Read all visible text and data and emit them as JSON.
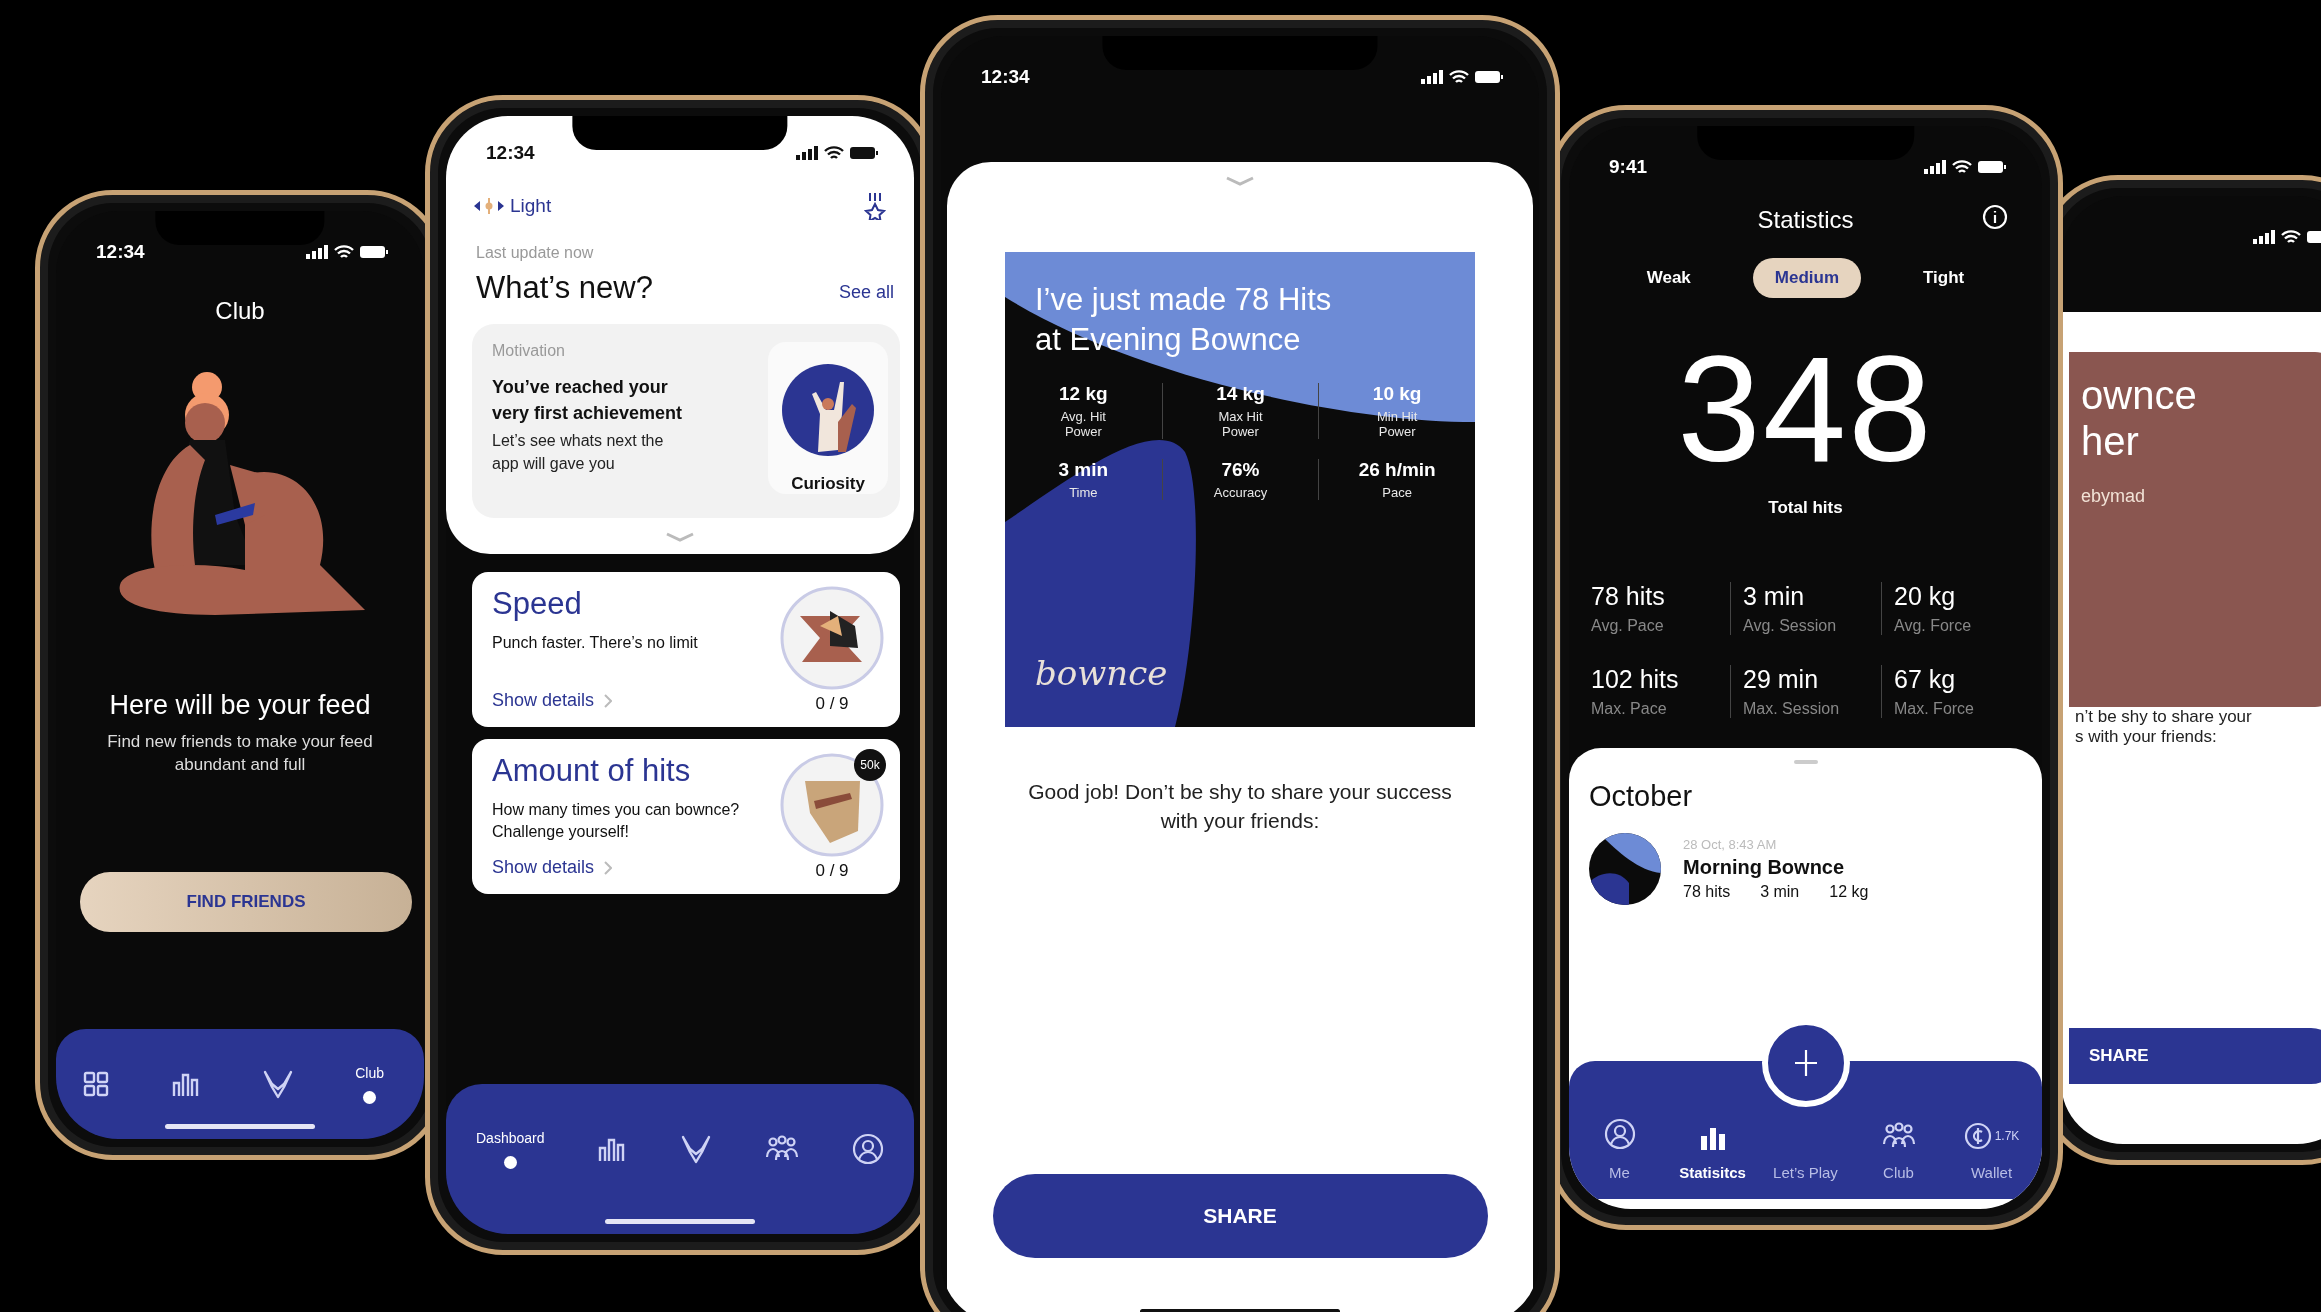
{
  "club_phone": {
    "time": "12:34",
    "title": "Club",
    "heading": "Here will be your feed",
    "text": "Find new friends to make your feed abundant and full",
    "button": "FIND FRIENDS",
    "nav": [
      {
        "selected": false
      },
      {
        "selected": false
      },
      {
        "selected": false
      },
      {
        "label": "Club",
        "selected": true
      }
    ]
  },
  "dashboard_phone": {
    "time": "12:34",
    "mode": "Light",
    "last_update": "Last update now",
    "heading": "What’s new?",
    "see_all": "See all",
    "motivation": {
      "category": "Motivation",
      "title": "You’ve reached your very first achievement",
      "text": "Let’s see whats next the app will gave you",
      "badge": "Curiosity"
    },
    "challenges": [
      {
        "title": "Speed",
        "text": "Punch faster. There’s no limit",
        "link": "Show details",
        "progress": "0 / 9"
      },
      {
        "title": "Amount of hits",
        "text": "How many times you can bownce? Challenge yourself!",
        "link": "Show details",
        "progress": "0 / 9",
        "badge": "50k"
      }
    ],
    "nav": [
      {
        "label": "Dashboard",
        "selected": true
      },
      {
        "selected": false
      },
      {
        "selected": false
      },
      {
        "selected": false
      },
      {
        "selected": false
      }
    ]
  },
  "share_phone": {
    "time": "12:34",
    "headline": "I’ve just made 78 Hits at Evening Bownce",
    "stats": [
      {
        "value": "12 kg",
        "label": "Avg. Hit Power"
      },
      {
        "value": "14 kg",
        "label": "Max Hit Power"
      },
      {
        "value": "10 kg",
        "label": "Min Hit Power"
      },
      {
        "value": "3 min",
        "label": "Time"
      },
      {
        "value": "76%",
        "label": "Accuracy"
      },
      {
        "value": "26 h/min",
        "label": "Pace"
      }
    ],
    "logo": "bownce",
    "message": "Good job! Don’t be shy to share your success with your friends:",
    "button": "SHARE"
  },
  "statistics_phone": {
    "time": "9:41",
    "title": "Statistics",
    "tabs": [
      {
        "label": "Weak",
        "selected": false
      },
      {
        "label": "Medium",
        "selected": true
      },
      {
        "label": "Tight",
        "selected": false
      }
    ],
    "total": "348",
    "total_label": "Total hits",
    "stats": [
      {
        "value": "78 hits",
        "label": "Avg. Pace"
      },
      {
        "value": "3 min",
        "label": "Avg. Session"
      },
      {
        "value": "20 kg",
        "label": "Avg. Force"
      },
      {
        "value": "102 hits",
        "label": "Max. Pace"
      },
      {
        "value": "29 min",
        "label": "Max. Session"
      },
      {
        "value": "67 kg",
        "label": "Max. Force"
      }
    ],
    "month": "October",
    "session": {
      "date": "28 Oct, 8:43 AM",
      "title": "Morning Bownce",
      "hits": "78 hits",
      "time": "3 min",
      "weight": "12 kg"
    },
    "nav": [
      {
        "label": "Me",
        "selected": false
      },
      {
        "label": "Statisitcs",
        "selected": true
      },
      {
        "label": "Let’s Play",
        "selected": false
      },
      {
        "label": "Club",
        "selected": false
      },
      {
        "label": "Wallet",
        "selected": false,
        "balance": "1.7K"
      }
    ]
  },
  "partial_share_phone": {
    "title_lines": [
      "ownce",
      "her"
    ],
    "author": "ebymad",
    "message_lines": [
      "n’t be shy to share your",
      "s with your friends:"
    ],
    "button": "SHARE"
  }
}
